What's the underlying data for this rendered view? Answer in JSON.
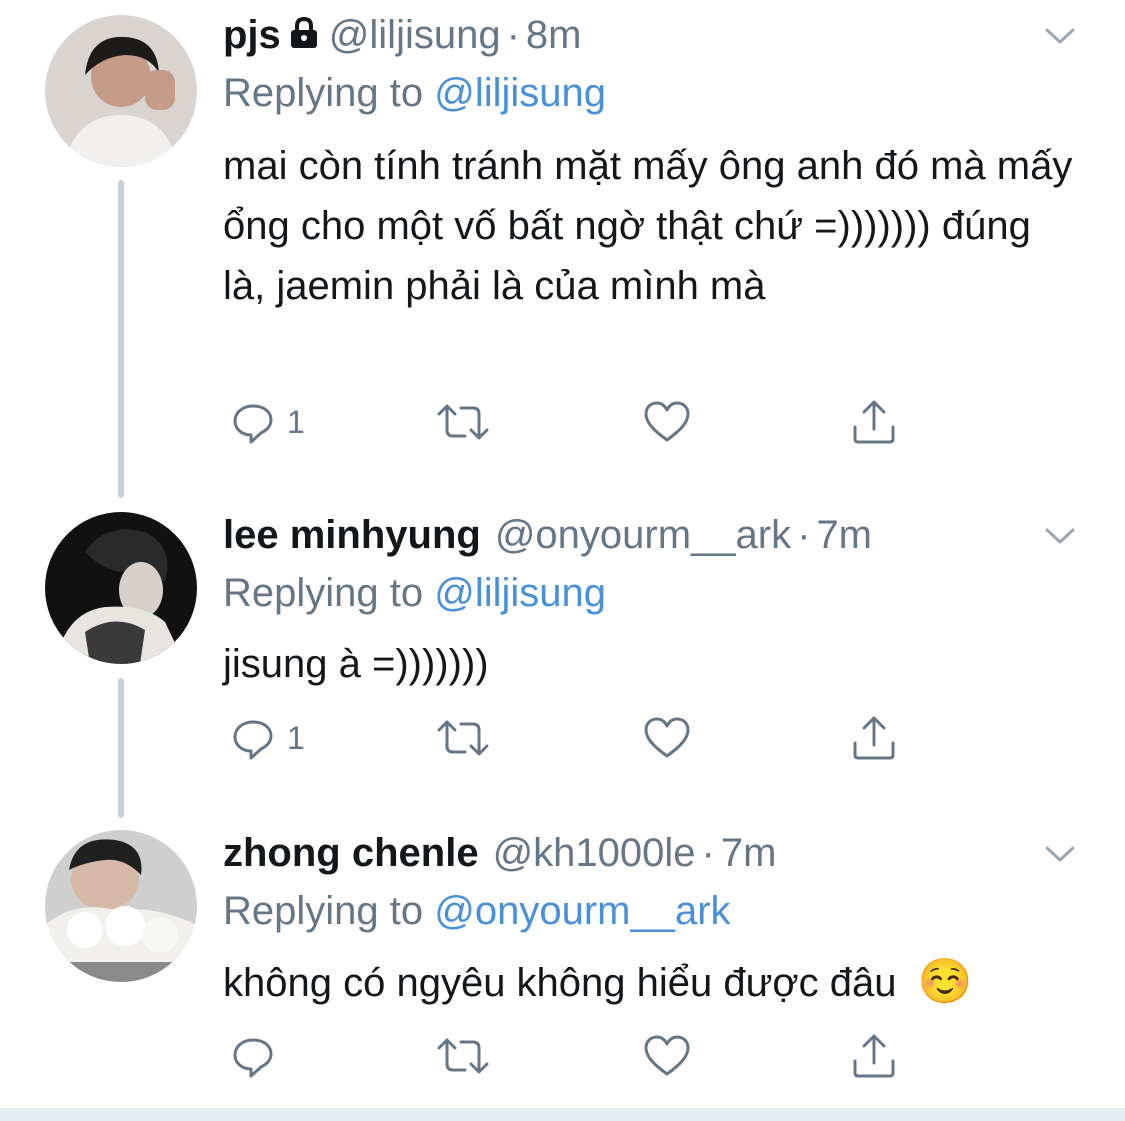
{
  "tweets": [
    {
      "display_name": "pjs",
      "locked": true,
      "handle": "@liljisung",
      "time": "8m",
      "replying_prefix": "Replying to ",
      "replying_to": "@liljisung",
      "text": "mai còn tính tránh mặt mấy ông anh đó mà mấy ổng cho một vố bất ngờ thật chứ =))))))) đúng là, jaemin phải là của mình mà",
      "reply_count": "1"
    },
    {
      "display_name": "lee minhyung",
      "locked": false,
      "handle": "@onyourm__ark",
      "time": "7m",
      "replying_prefix": "Replying to ",
      "replying_to": "@liljisung",
      "text": "jisung à =)))))))",
      "reply_count": "1"
    },
    {
      "display_name": "zhong chenle",
      "locked": false,
      "handle": "@kh1000le",
      "time": "7m",
      "replying_prefix": "Replying to ",
      "replying_to": "@onyourm__ark",
      "text": "không có ngyêu không hiểu được đâu",
      "emoji": "☺️",
      "reply_count": ""
    }
  ],
  "separator": "·",
  "icons": [
    "reply-icon",
    "retweet-icon",
    "like-icon",
    "share-icon",
    "lock-icon",
    "caret-down-icon"
  ],
  "colors": {
    "link": "#4a90d9",
    "muted": "#657786",
    "text": "#14171a",
    "thread_line": "#c4cfd6"
  }
}
